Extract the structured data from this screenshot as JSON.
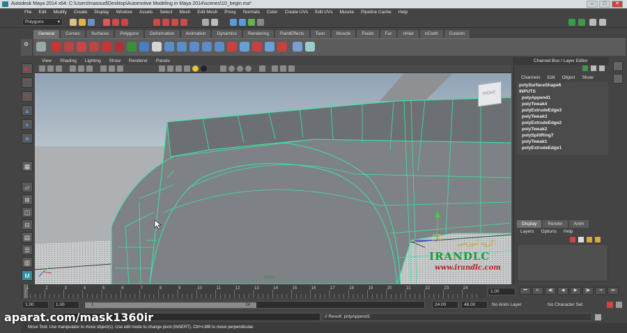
{
  "window": {
    "title": "Autodesk Maya 2014 x64: C:\\Users\\masoud\\Desktop\\Automotive Modeling in Maya 2014\\scenes\\10_begin.ma*",
    "min": "–",
    "max": "□",
    "close": "✕"
  },
  "menubar": [
    "File",
    "Edit",
    "Modify",
    "Create",
    "Display",
    "Window",
    "Assets",
    "Select",
    "Mesh",
    "Edit Mesh",
    "Proxy",
    "Normals",
    "Color",
    "Create UVs",
    "Edit UVs",
    "Muscle",
    "Pipeline Cache",
    "Help"
  ],
  "status": {
    "mode": "Polygons"
  },
  "shelf": {
    "tabs": [
      "General",
      "Curves",
      "Surfaces",
      "Polygons",
      "Deformation",
      "Animation",
      "Dynamics",
      "Rendering",
      "PaintEffects",
      "Toon",
      "Muscle",
      "Fluids",
      "Fur",
      "nHair",
      "nCloth",
      "Custom"
    ],
    "active_tab": "General"
  },
  "panel": {
    "menus": [
      "View",
      "Shading",
      "Lighting",
      "Show",
      "Renderer",
      "Panels"
    ],
    "viewcube_label": "RIGHT",
    "persp_label": "persp"
  },
  "overlay": {
    "logo_text": "IRANDLC",
    "logo_url": "www.irandlc.com",
    "logo_tagline": "گروه آموزشی"
  },
  "channel_box": {
    "title": "Channel Box / Layer Editor",
    "menus": [
      "Channels",
      "Edit",
      "Object",
      "Show"
    ],
    "shape": "polySurfaceShape6",
    "inputs_label": "INPUTS",
    "inputs": [
      "polyAppend1",
      "polyTweak4",
      "polyExtrudeEdge3",
      "polyTweak3",
      "polyExtrudeEdge2",
      "polyTweak2",
      "polySplitRing7",
      "polyTweak1",
      "polyExtrudeEdge1"
    ]
  },
  "layer_editor": {
    "tabs": [
      "Display",
      "Render",
      "Anim"
    ],
    "active_tab": "Display",
    "menus": [
      "Layers",
      "Options",
      "Help"
    ]
  },
  "timeline": {
    "ticks": [
      "1",
      "2",
      "3",
      "4",
      "5",
      "6",
      "7",
      "8",
      "9",
      "10",
      "11",
      "12",
      "13",
      "14",
      "15",
      "16",
      "17",
      "18",
      "19",
      "20",
      "21",
      "22",
      "23",
      "24"
    ],
    "current_frame": "1.00",
    "controls": [
      "⏮",
      "⇤",
      "◀|",
      "◀",
      "▶",
      "|▶",
      "⇥",
      "⏭"
    ]
  },
  "range": {
    "start": "1.00",
    "start2": "1.00",
    "slider_start": "1",
    "slider_end": "24",
    "end": "24.00",
    "end2": "48.00",
    "anim_layer": "No Anim Layer",
    "char_set": "No Character Set"
  },
  "command": {
    "result": "// Result: polyAppend1"
  },
  "helpline": "Move Tool: Use manipulator to move object(s). Use edit mode to change pivot (INSERT). Ctrl+LMB to move perpendicular.",
  "watermark": "aparat.com/mask1360ir"
}
